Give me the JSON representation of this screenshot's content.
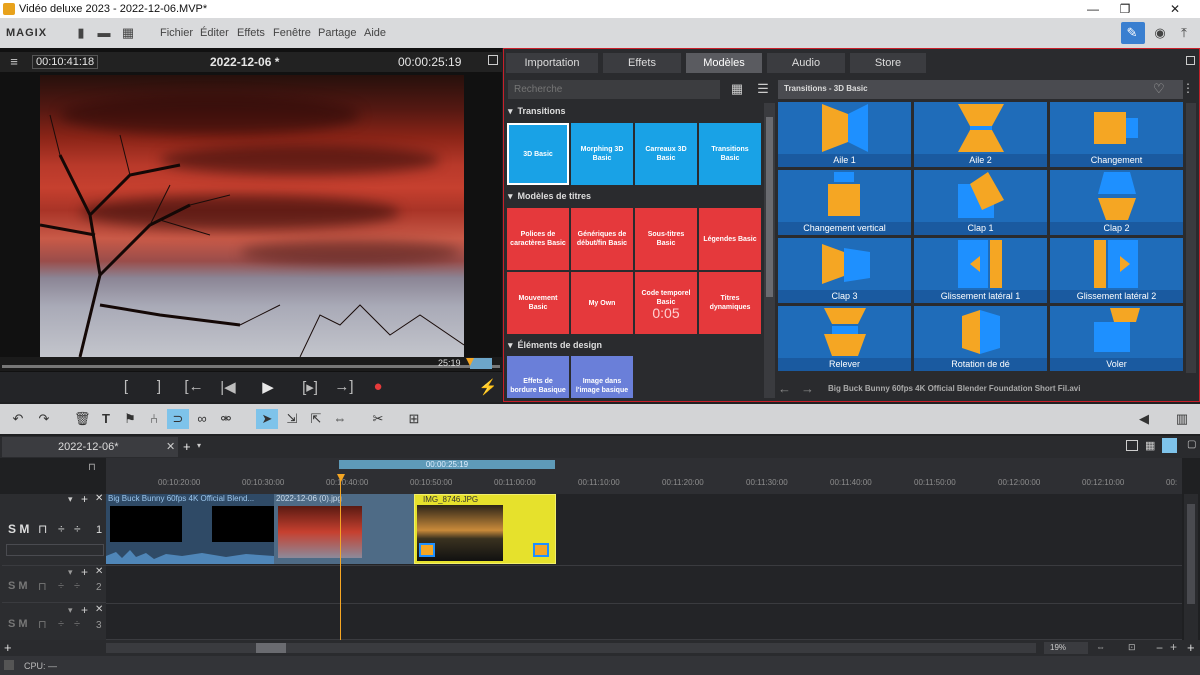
{
  "window": {
    "title": "Vidéo deluxe 2023 - 2022-12-06.MVP*",
    "minimize": "—",
    "maximize": "❐",
    "close": "✕"
  },
  "menu": {
    "logo": "MAGIX",
    "items": [
      "Fichier",
      "Éditer",
      "Effets",
      "Fenêtre",
      "Partage",
      "Aide"
    ]
  },
  "preview": {
    "timecode_left": "00:10:41:18",
    "title": "2022-12-06 *",
    "timecode_right": "00:00:25:19",
    "scrub_label": "25:19"
  },
  "transport": {
    "buttons": [
      "[",
      "]",
      "[←",
      "|◀",
      "▶",
      "[▸]",
      "→]",
      "●",
      "⚡"
    ]
  },
  "panel": {
    "tabs": [
      "Importation",
      "Effets",
      "Modèles",
      "Audio",
      "Store"
    ],
    "active_tab": "Modèles",
    "search_placeholder": "Recherche",
    "sections": [
      {
        "title": "Transitions",
        "tiles": [
          "3D Basic",
          "Morphing 3D Basic",
          "Carreaux 3D Basic",
          "Transitions Basic"
        ],
        "color": "blue"
      },
      {
        "title": "Modèles de titres",
        "tiles": [
          "Polices de caractères Basic",
          "Génériques de début/fin Basic",
          "Sous-titres Basic",
          "Légendes Basic",
          "Mouvement Basic",
          "My Own",
          "Code temporel Basic",
          "Titres dynamiques"
        ],
        "color": "red"
      },
      {
        "title": "Éléments de design",
        "tiles": [
          "Effets de bordure Basique",
          "Image dans l'image basique"
        ],
        "color": "purple"
      }
    ],
    "grid_title": "Transitions - 3D Basic",
    "transitions": [
      "Aile 1",
      "Aile 2",
      "Changement",
      "Changement vertical",
      "Clap 1",
      "Clap 2",
      "Clap 3",
      "Glissement latéral 1",
      "Glissement latéral 2",
      "Relever",
      "Rotation de dé",
      "Voler"
    ],
    "footer": "Big Buck Bunny 60fps 4K   Official Blender Foundation Short Fil.avi",
    "timecode_sample": "0:05"
  },
  "timeline": {
    "tab": "2022-12-06*",
    "range_label": "00:00:25:19",
    "ticks": [
      "00:10:20:00",
      "00:10:30:00",
      "00:10:40:00",
      "00:10:50:00",
      "00:11:00:00",
      "00:11:10:00",
      "00:11:20:00",
      "00:11:30:00",
      "00:11:40:00",
      "00:11:50:00",
      "00:12:00:00",
      "00:12:10:00",
      "00:"
    ],
    "tracks": [
      {
        "num": "1"
      },
      {
        "num": "2"
      },
      {
        "num": "3"
      }
    ],
    "track_controls": "S M",
    "clips": [
      {
        "name": "Big Buck Bunny 60fps 4K   Official Blend..."
      },
      {
        "name": "2022-12-06 (0).jpg"
      },
      {
        "name": "IMG_8746.JPG"
      }
    ],
    "zoom": "19%"
  },
  "status": {
    "cpu": "CPU: —"
  },
  "colors": {
    "accent_red": "#c8202a",
    "tile_blue": "#19a2e6",
    "tile_red": "#e5393c",
    "grid_blue": "#1f6cb9",
    "shape_orange": "#f5a623",
    "clip_yellow": "#e6e12c"
  }
}
